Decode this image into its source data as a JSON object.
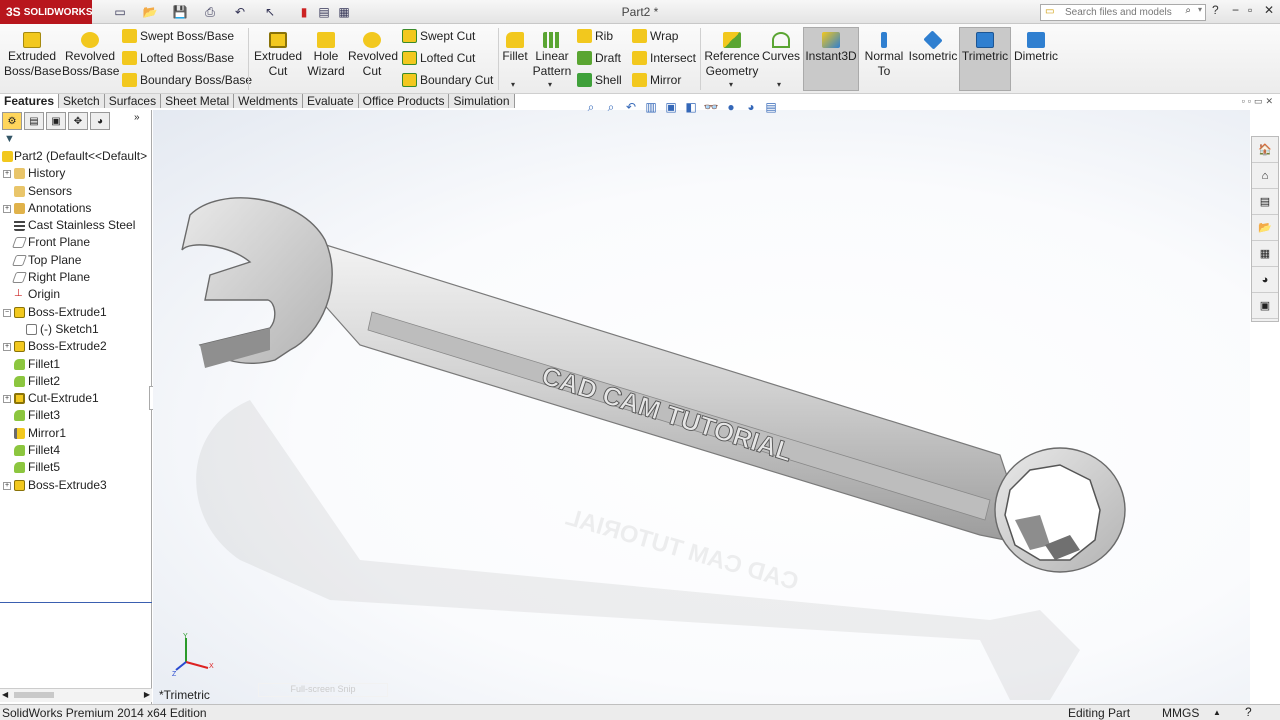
{
  "app": {
    "brand_ds": "3S",
    "brand": "SOLIDWORKS",
    "document_title": "Part2 *",
    "search_placeholder": "Search files and models",
    "help_label": "?"
  },
  "ribbon": {
    "extruded_boss": "Extruded Boss/Base",
    "revolved_boss": "Revolved Boss/Base",
    "swept_boss": "Swept Boss/Base",
    "lofted_boss": "Lofted Boss/Base",
    "boundary_boss": "Boundary Boss/Base",
    "extruded_cut": "Extruded Cut",
    "hole_wizard": "Hole Wizard",
    "revolved_cut": "Revolved Cut",
    "swept_cut": "Swept Cut",
    "lofted_cut": "Lofted Cut",
    "boundary_cut": "Boundary Cut",
    "fillet": "Fillet",
    "linear_pattern": "Linear Pattern",
    "rib": "Rib",
    "draft": "Draft",
    "shell": "Shell",
    "wrap": "Wrap",
    "intersect": "Intersect",
    "mirror": "Mirror",
    "reference_geometry": "Reference Geometry",
    "curves": "Curves",
    "instant3d": "Instant3D",
    "normal_to": "Normal To",
    "isometric": "Isometric",
    "trimetric": "Trimetric",
    "dimetric": "Dimetric"
  },
  "tabs": [
    "Features",
    "Sketch",
    "Surfaces",
    "Sheet Metal",
    "Weldments",
    "Evaluate",
    "Office Products",
    "Simulation"
  ],
  "tree": {
    "root": "Part2  (Default<<Default>",
    "items": [
      "History",
      "Sensors",
      "Annotations",
      "Cast Stainless Steel",
      "Front Plane",
      "Top Plane",
      "Right Plane",
      "Origin",
      "Boss-Extrude1",
      "(-) Sketch1",
      "Boss-Extrude2",
      "Fillet1",
      "Fillet2",
      "Cut-Extrude1",
      "Fillet3",
      "Mirror1",
      "Fillet4",
      "Fillet5",
      "Boss-Extrude3"
    ]
  },
  "model": {
    "engraving": "CAD CAM TUTORIAL"
  },
  "viewport": {
    "view_label": "*Trimetric",
    "snip_hint": "Full-screen Snip",
    "triad_x": "X",
    "triad_y": "Y",
    "triad_z": "Z"
  },
  "status": {
    "edition": "SolidWorks Premium 2014 x64 Edition",
    "mode": "Editing Part",
    "units": "MMGS",
    "help": "?"
  },
  "colors": {
    "brand_red": "#b8161d",
    "icon_yellow": "#f2c81e",
    "icon_green": "#5aa532",
    "icon_blue": "#2f7fd0",
    "tree_line": "#3a5fb0"
  }
}
